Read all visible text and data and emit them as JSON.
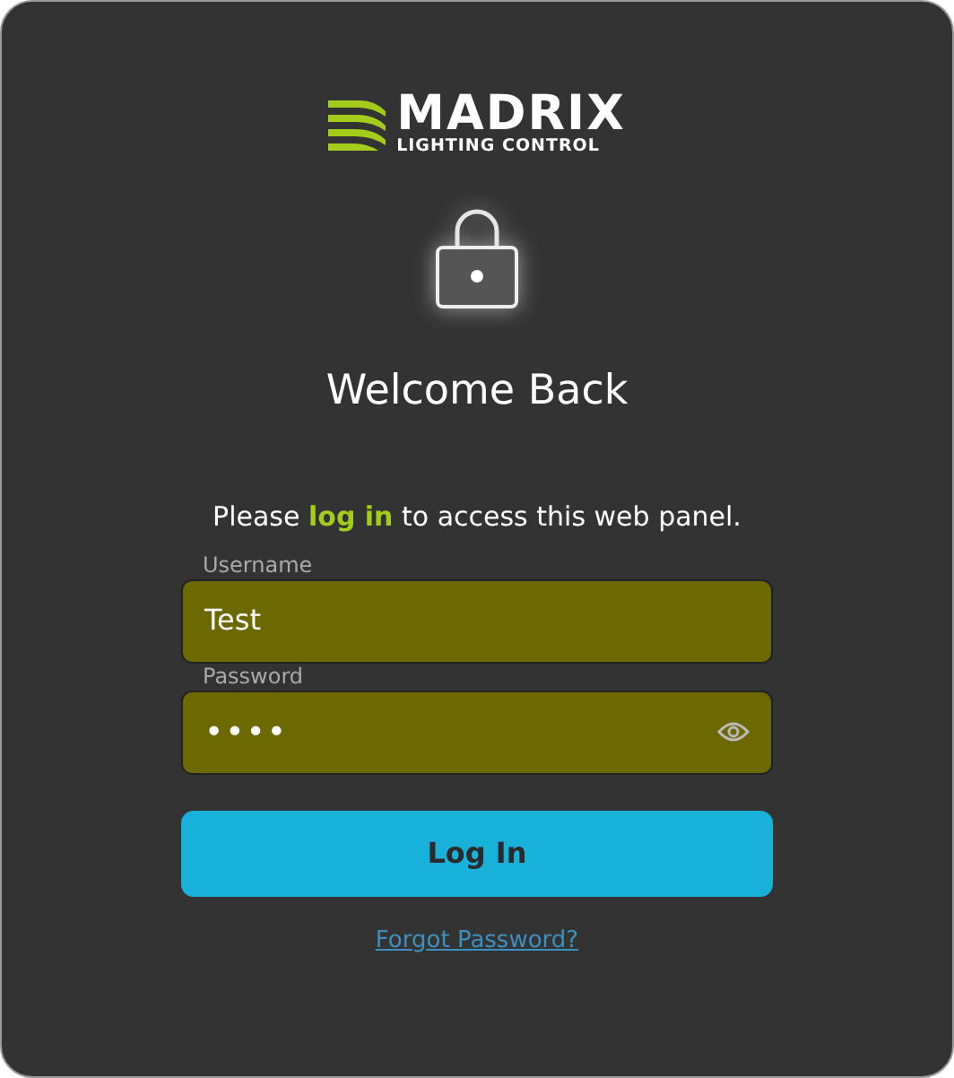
{
  "logo": {
    "name": "MADRIX",
    "tagline": "LIGHTING CONTROL"
  },
  "heading": "Welcome Back",
  "intro": "Please **log in** to access this web panel.",
  "fields": [
    {
      "label": "Username",
      "value": "Test",
      "kind": "text"
    },
    {
      "label": "Password",
      "value": "••••",
      "kind": "password"
    }
  ],
  "login_button": "Log In",
  "forgot_link": "Forgot Password?"
}
